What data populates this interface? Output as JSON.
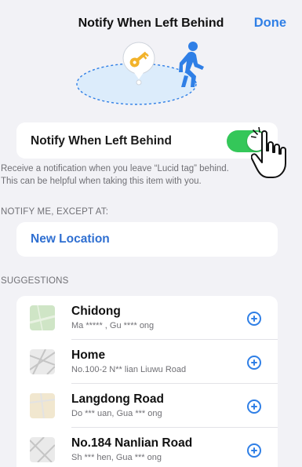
{
  "nav": {
    "title": "Notify When Left Behind",
    "done_label": "Done"
  },
  "hero": {
    "item_icon": "key-icon",
    "person_icon": "walking-person-icon",
    "accent": "#2f7fe6",
    "key_color": "#f2b32b"
  },
  "toggle": {
    "label": "Notify When Left Behind",
    "state": "on",
    "on_color": "#34c759"
  },
  "description": {
    "line1": "Receive a notification when you leave “Lucid tag” behind.",
    "line2": "This can be helpful when taking this item with you."
  },
  "except_section": {
    "header": "NOTIFY ME, EXCEPT AT:",
    "new_location_label": "New Location"
  },
  "suggestions": {
    "header": "SUGGESTIONS",
    "items": [
      {
        "title": "Chidong",
        "subtitle": "Ma ***** , Gu **** ong",
        "thumb": "green-map-thumbnail"
      },
      {
        "title": "Home",
        "subtitle": "No.100-2 N** lian Liuwu Road",
        "thumb": "street-map-thumbnail"
      },
      {
        "title": "Langdong Road",
        "subtitle": "Do *** uan, Gua *** ong",
        "thumb": "beige-map-thumbnail"
      },
      {
        "title": "No.184 Nanlian Road",
        "subtitle": "Sh *** hen, Gua *** ong",
        "thumb": "street-map-thumbnail"
      }
    ],
    "add_icon": "plus-circle-icon"
  }
}
